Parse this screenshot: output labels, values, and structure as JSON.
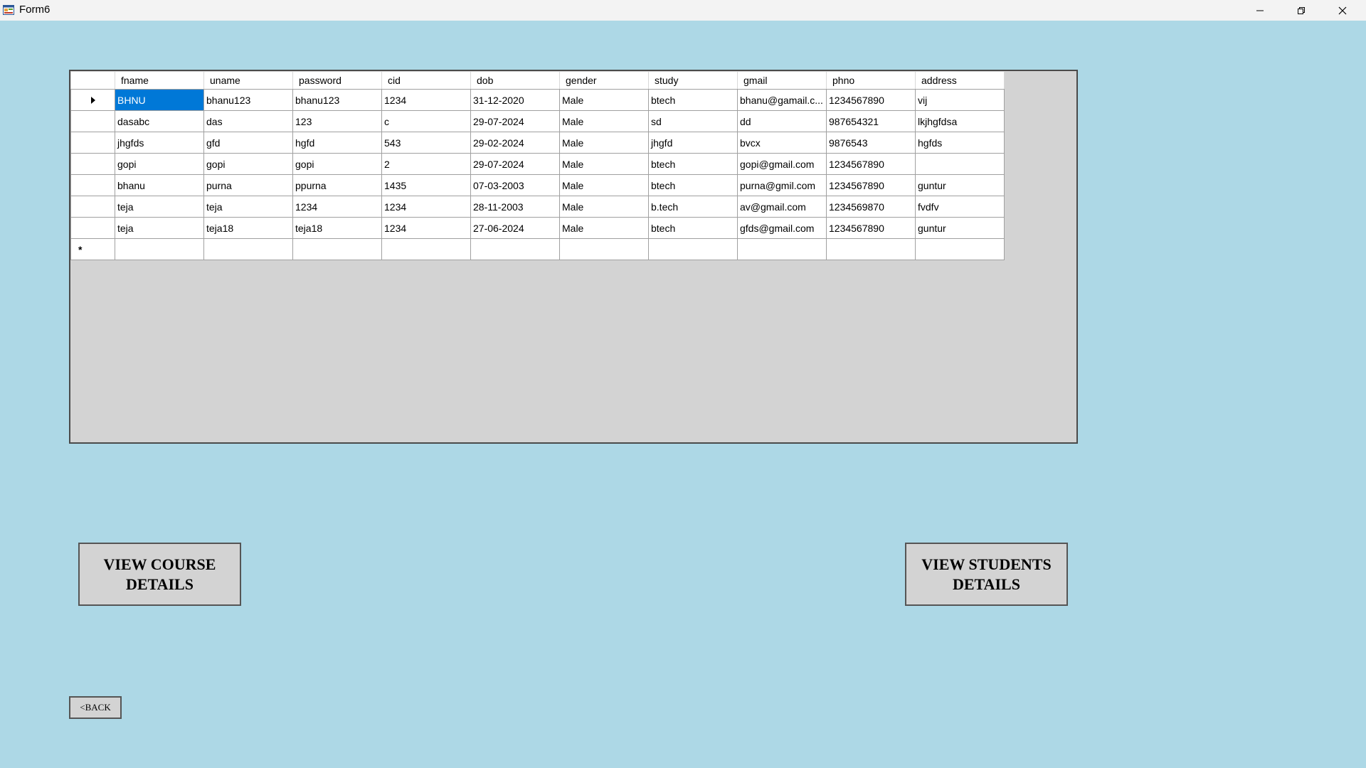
{
  "window": {
    "title": "Form6"
  },
  "grid": {
    "columns": [
      "fname",
      "uname",
      "password",
      "cid",
      "dob",
      "gender",
      "study",
      "gmail",
      "phno",
      "address"
    ],
    "rows": [
      [
        "BHNU",
        "bhanu123",
        "bhanu123",
        "1234",
        "31-12-2020",
        "Male",
        "btech",
        "bhanu@gamail.c...",
        "1234567890",
        "vij"
      ],
      [
        "dasabc",
        "das",
        "123",
        "c",
        "29-07-2024",
        "Male",
        "sd",
        "dd",
        "987654321",
        "lkjhgfdsa"
      ],
      [
        "jhgfds",
        "gfd",
        "hgfd",
        "543",
        "29-02-2024",
        "Male",
        "jhgfd",
        "bvcx",
        "9876543",
        "hgfds"
      ],
      [
        "gopi",
        "gopi",
        "gopi",
        "2",
        "29-07-2024",
        "Male",
        "btech",
        "gopi@gmail.com",
        "1234567890",
        ""
      ],
      [
        "bhanu",
        "purna",
        "ppurna",
        "1435",
        "07-03-2003",
        "Male",
        "btech",
        "purna@gmil.com",
        "1234567890",
        "guntur"
      ],
      [
        "teja",
        "teja",
        "1234",
        "1234",
        "28-11-2003",
        "Male",
        "b.tech",
        "av@gmail.com",
        "1234569870",
        "fvdfv"
      ],
      [
        "teja",
        "teja18",
        "teja18",
        "1234",
        "27-06-2024",
        "Male",
        "btech",
        "gfds@gmail.com",
        "1234567890",
        "guntur"
      ]
    ],
    "new_row_marker": "*",
    "selected_cell": {
      "row": 0,
      "col": 0
    },
    "selection_color": "#0078d7"
  },
  "buttons": {
    "view_course": "VIEW  COURSE\nDETAILS",
    "view_students": "VIEW STUDENTS\nDETAILS",
    "back": "<BACK"
  },
  "icons": {
    "app": "app-window-icon",
    "minimize": "minimize-icon",
    "maximize": "restore-icon",
    "close": "close-icon",
    "current_row": "row-pointer-icon"
  },
  "colors": {
    "background": "#add8e6",
    "grid_background": "#d3d3d3",
    "button_face": "#d3d3d3"
  }
}
